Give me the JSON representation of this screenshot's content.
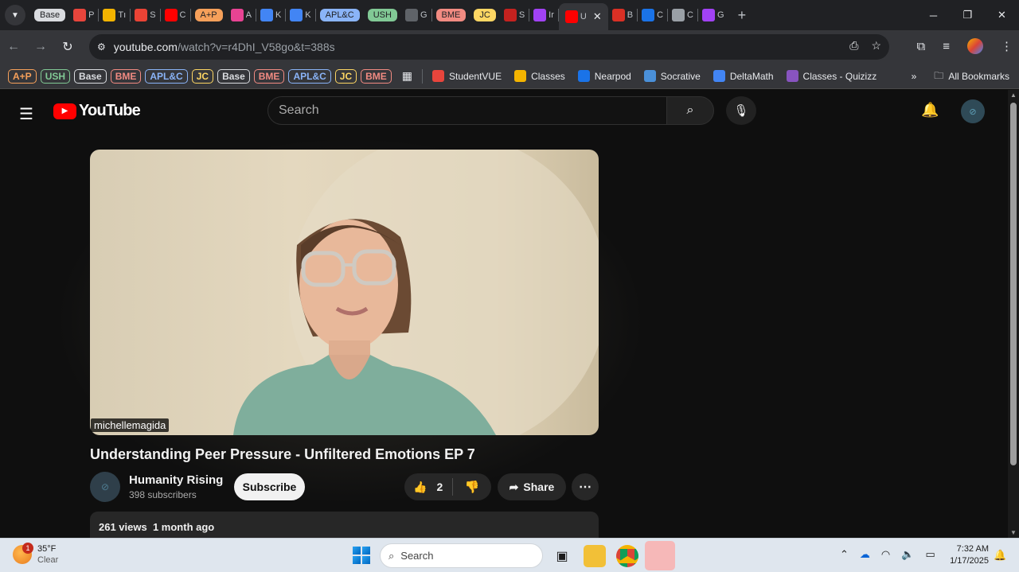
{
  "browser": {
    "tabs": [
      {
        "kind": "group",
        "label": "Base",
        "color": "#dadce0"
      },
      {
        "kind": "tab",
        "label": "P",
        "icon": "pinwheel-icon",
        "color": "#e8453c"
      },
      {
        "kind": "tab",
        "label": "Tı",
        "icon": "classroom-icon",
        "color": "#f4b400"
      },
      {
        "kind": "tab",
        "label": "S",
        "icon": "gmail-icon",
        "color": "#ea4335"
      },
      {
        "kind": "tab",
        "label": "C",
        "icon": "youtube-icon",
        "color": "#ff0000"
      },
      {
        "kind": "group",
        "label": "A+P",
        "color": "#f6a05a"
      },
      {
        "kind": "tab",
        "label": "A",
        "icon": "assignment-icon",
        "color": "#e84393"
      },
      {
        "kind": "tab",
        "label": "K",
        "icon": "docs-icon",
        "color": "#4285f4"
      },
      {
        "kind": "tab",
        "label": "K",
        "icon": "docs-icon",
        "color": "#4285f4"
      },
      {
        "kind": "group",
        "label": "APL&C",
        "color": "#8ab4f8"
      },
      {
        "kind": "group",
        "label": "USH",
        "color": "#81c995"
      },
      {
        "kind": "tab",
        "label": "G",
        "icon": "athena-icon",
        "color": "#5f6368"
      },
      {
        "kind": "group",
        "label": "BME",
        "color": "#f28b82"
      },
      {
        "kind": "group",
        "label": "JC",
        "color": "#fdd663"
      },
      {
        "kind": "tab",
        "label": "S",
        "icon": "sparknotes-icon",
        "color": "#c5221f"
      },
      {
        "kind": "tab",
        "label": "Ir",
        "icon": "purple-face-icon",
        "color": "#a142f4"
      },
      {
        "kind": "active",
        "label": "U",
        "icon": "youtube-icon",
        "color": "#ff0000"
      },
      {
        "kind": "tab",
        "label": "B",
        "icon": "bookcreator-icon",
        "color": "#d93025"
      },
      {
        "kind": "tab",
        "label": "C",
        "icon": "cloud-icon",
        "color": "#1a73e8"
      },
      {
        "kind": "tab",
        "label": "C",
        "icon": "image-icon",
        "color": "#9aa0a6"
      },
      {
        "kind": "tab",
        "label": "G",
        "icon": "g-icon",
        "color": "#a142f4"
      }
    ],
    "url_host": "youtube.com",
    "url_rest": "/watch?v=r4DhI_V58go&t=388s",
    "bookmark_groups": [
      {
        "label": "A+P",
        "color": "#f6a05a"
      },
      {
        "label": "USH",
        "color": "#81c995"
      },
      {
        "label": "Base",
        "color": "#dadce0"
      },
      {
        "label": "BME",
        "color": "#f28b82"
      },
      {
        "label": "APL&C",
        "color": "#8ab4f8"
      },
      {
        "label": "JC",
        "color": "#fdd663"
      },
      {
        "label": "Base",
        "color": "#dadce0"
      },
      {
        "label": "BME",
        "color": "#f28b82"
      },
      {
        "label": "APL&C",
        "color": "#8ab4f8"
      },
      {
        "label": "JC",
        "color": "#fdd663"
      },
      {
        "label": "BME",
        "color": "#f28b82"
      }
    ],
    "bookmarks": [
      {
        "label": "StudentVUE",
        "icon": "studentvue-icon",
        "color": "#e8453c"
      },
      {
        "label": "Classes",
        "icon": "classroom-icon",
        "color": "#f4b400"
      },
      {
        "label": "Nearpod",
        "icon": "nearpod-icon",
        "color": "#1a73e8"
      },
      {
        "label": "Socrative",
        "icon": "socrative-icon",
        "color": "#4a90d9"
      },
      {
        "label": "DeltaMath",
        "icon": "deltamath-icon",
        "color": "#4285f4"
      },
      {
        "label": "Classes - Quizizz",
        "icon": "quizizz-icon",
        "color": "#8854c0"
      }
    ],
    "all_bookmarks": "All Bookmarks"
  },
  "youtube": {
    "logo_text": "YouTube",
    "search_placeholder": "Search",
    "video_overlay_name": "michellemagida",
    "title": "Understanding Peer Pressure - Unfiltered Emotions EP 7",
    "channel_name": "Humanity Rising",
    "subscribers": "398 subscribers",
    "subscribe_label": "Subscribe",
    "likes": "2",
    "share_label": "Share",
    "views": "261 views",
    "age": "1 month ago"
  },
  "taskbar": {
    "badge": "1",
    "temperature": "35°F",
    "condition": "Clear",
    "search_label": "Search",
    "time": "7:32 AM",
    "date": "1/17/2025"
  }
}
